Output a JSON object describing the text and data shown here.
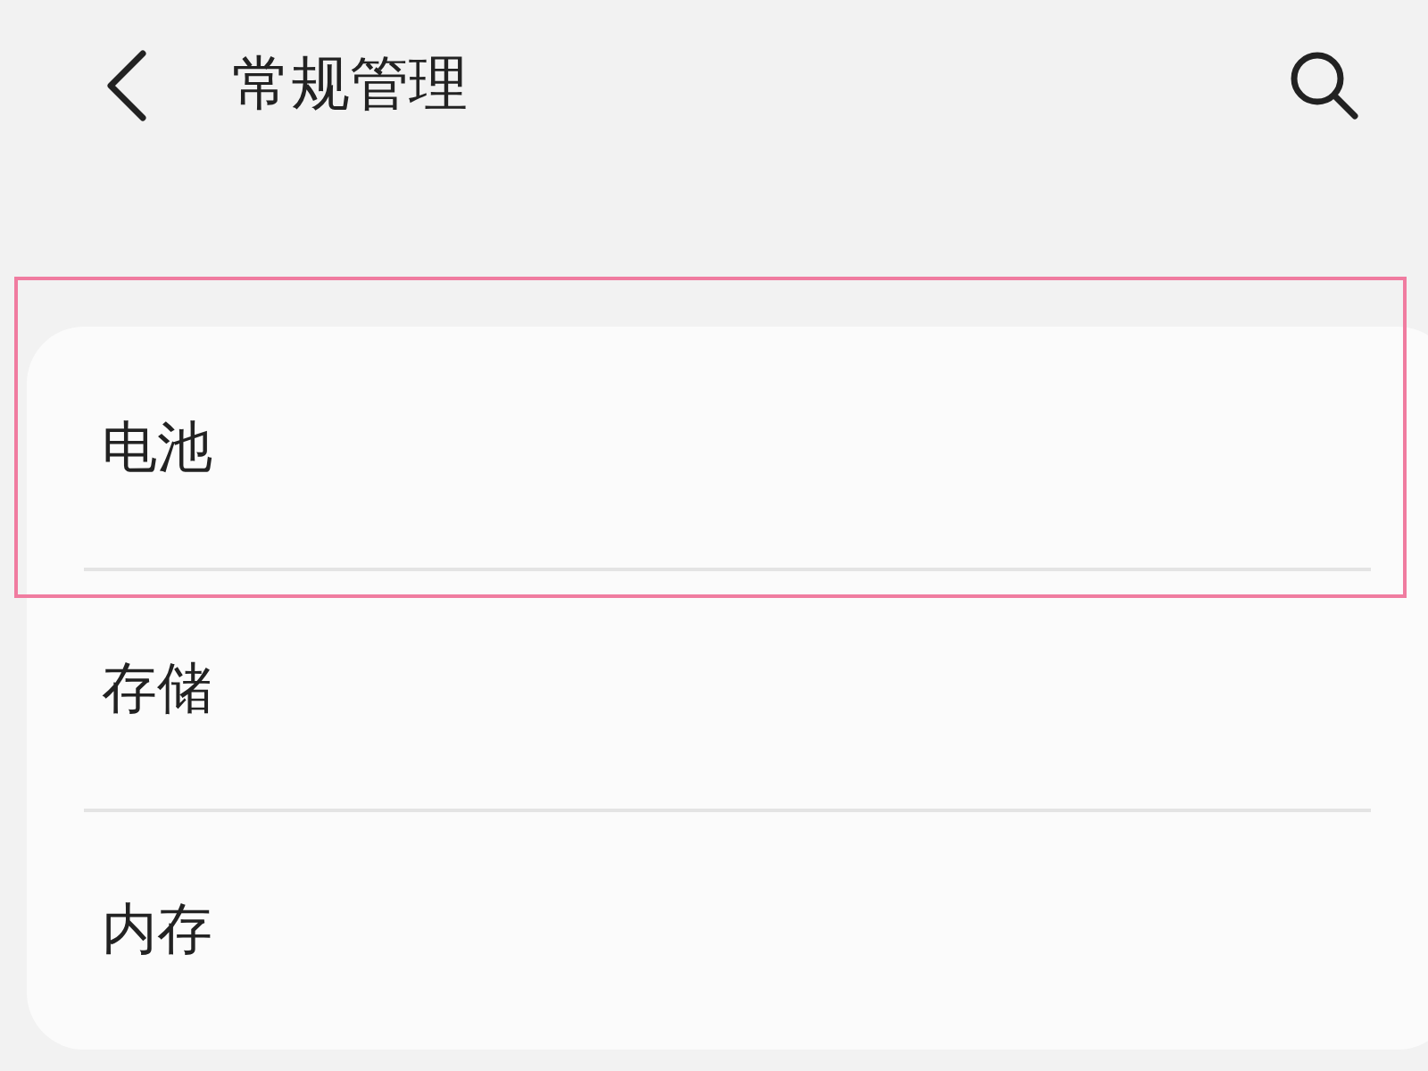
{
  "header": {
    "title": "常规管理"
  },
  "items": [
    {
      "label": "电池",
      "highlighted": true
    },
    {
      "label": "存储",
      "highlighted": false
    },
    {
      "label": "内存",
      "highlighted": false
    }
  ]
}
